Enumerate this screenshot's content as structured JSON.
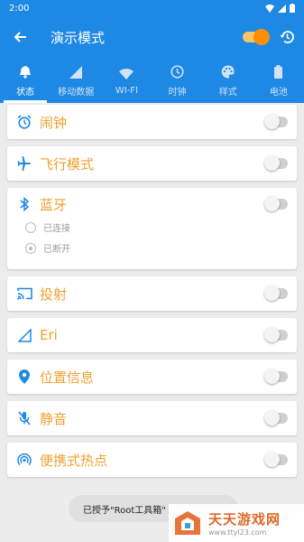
{
  "status_bar": {
    "time": "2:00"
  },
  "app_bar": {
    "title": "演示模式"
  },
  "tabs": [
    {
      "label": "状态",
      "icon": "bell-icon",
      "active": true
    },
    {
      "label": "移动数据",
      "icon": "signal-icon"
    },
    {
      "label": "WI-FI",
      "icon": "wifi-icon"
    },
    {
      "label": "时钟",
      "icon": "clock-icon"
    },
    {
      "label": "样式",
      "icon": "palette-icon"
    },
    {
      "label": "电池",
      "icon": "battery-icon"
    }
  ],
  "items": [
    {
      "label": "闹钟",
      "icon": "alarm-icon",
      "checked": false
    },
    {
      "label": "飞行模式",
      "icon": "airplane-icon",
      "checked": false
    },
    {
      "label": "蓝牙",
      "icon": "bluetooth-icon",
      "checked": false
    },
    {
      "label": "投射",
      "icon": "cast-icon",
      "checked": false
    },
    {
      "label": "Eri",
      "icon": "signal-outline-icon",
      "checked": false
    },
    {
      "label": "位置信息",
      "icon": "location-icon",
      "checked": false
    },
    {
      "label": "静音",
      "icon": "mute-icon",
      "checked": false
    },
    {
      "label": "便携式热点",
      "icon": "hotspot-icon",
      "checked": false
    }
  ],
  "bluetooth_options": [
    {
      "label": "已连接",
      "selected": false
    },
    {
      "label": "已断开",
      "selected": true
    }
  ],
  "toast": {
    "text": "已授予\"Root工具箱\""
  },
  "watermark": {
    "title": "天天游戏网",
    "url": "www.ttyl23.com"
  },
  "colors": {
    "primary": "#1e88e5",
    "accent": "#ff8f00",
    "label": "#f0a030",
    "icon": "#1e88e5"
  }
}
